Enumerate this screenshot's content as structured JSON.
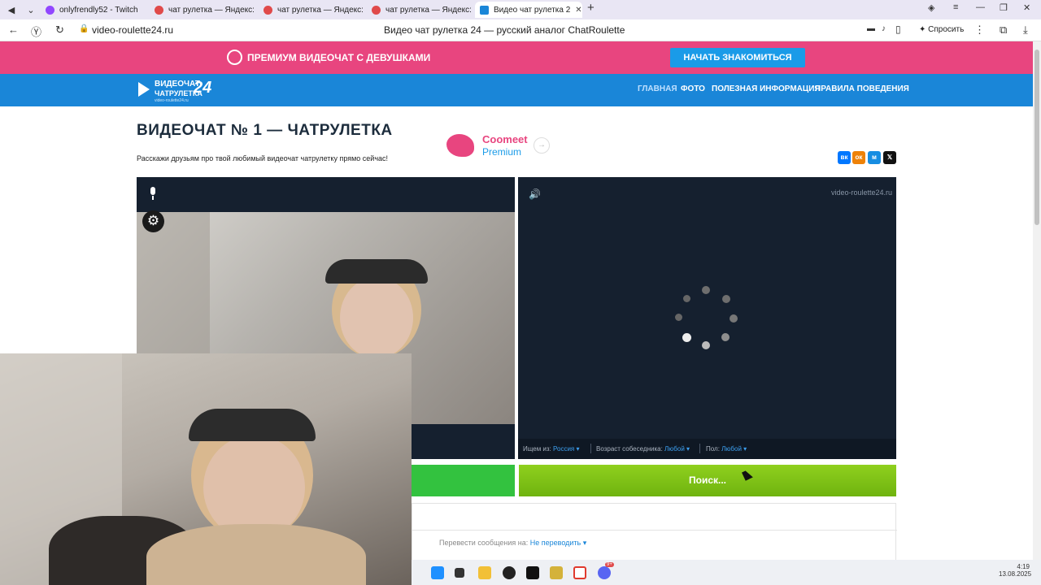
{
  "browser": {
    "tabs": [
      {
        "label": "onlyfrendly52 - Twitch",
        "color": "#9146ff"
      },
      {
        "label": "чат рулетка — Яндекс: на",
        "color": "#e04a4a"
      },
      {
        "label": "чат рулетка — Яндекс: на",
        "color": "#e04a4a"
      },
      {
        "label": "чат рулетка — Яндекс: на",
        "color": "#e04a4a"
      },
      {
        "label": "Видео чат рулетка 2",
        "color": "#1a86d8"
      }
    ],
    "url": "video-roulette24.ru",
    "page_title": "Видео чат рулетка 24 — русский аналог ChatRoulette",
    "ask_label": "Спросить",
    "win_controls": [
      "≡",
      "—",
      "❐",
      "✕"
    ]
  },
  "promo": {
    "text": "ПРЕМИУМ ВИДЕОЧАТ С ДЕВУШКАМИ",
    "button": "НАЧАТЬ ЗНАКОМИТЬСЯ"
  },
  "nav": {
    "logo_line1": "ВИДЕОЧАТ",
    "logo_line2": "ЧАТРУЛЕТКА",
    "logo_num": "24",
    "logo_sub": "video-roulette24.ru",
    "items": [
      "ГЛАВНАЯ",
      "ФОТО",
      "ПОЛЕЗНАЯ ИНФОРМАЦИЯ",
      "ПРАВИЛА ПОВЕДЕНИЯ"
    ]
  },
  "main": {
    "title": "ВИДЕОЧАТ № 1 — ЧАТРУЛЕТКА",
    "share_text": "Расскажи друзьям про твой любимый видеочат чатрулетку прямо сейчас!",
    "ad": {
      "line1": "Coomeet",
      "line2": "Premium",
      "arrow": "→"
    },
    "social": [
      {
        "label": "вк",
        "color": "#0077ff"
      },
      {
        "label": "ок",
        "color": "#ee8208"
      },
      {
        "label": "м",
        "color": "#168de2"
      },
      {
        "label": "𝕏",
        "color": "#111111"
      }
    ]
  },
  "video": {
    "watermark": "video-roulette24.ru",
    "filters": {
      "country_label": "Ищем из:",
      "country_value": "Россия",
      "age_label": "Возраст собеседника:",
      "age_value": "Любой",
      "gender_label": "Пол:",
      "gender_value": "Любой"
    },
    "search_button": "Поиск..."
  },
  "chat": {
    "translate_label": "Перевести сообщения на:",
    "translate_value": "Не переводить"
  },
  "taskbar": {
    "time": "4:19",
    "date": "13.08.2025",
    "badge": "9+"
  }
}
